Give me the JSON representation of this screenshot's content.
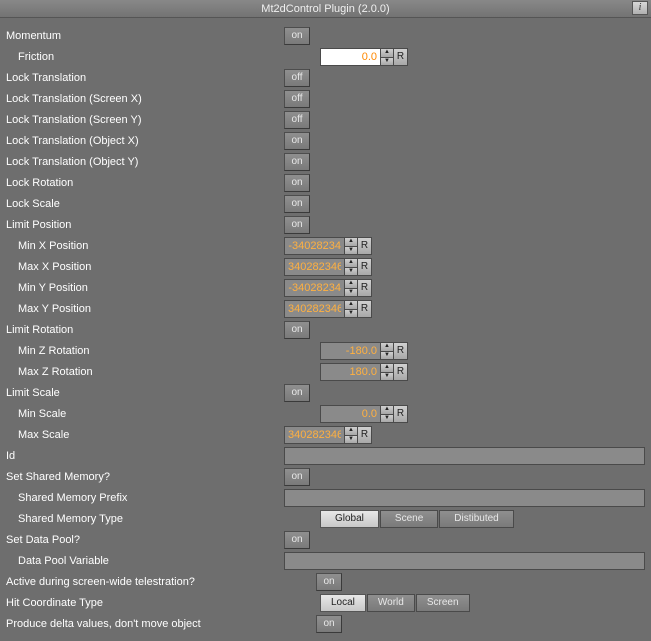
{
  "title": "Mt2dControl Plugin (2.0.0)",
  "info_label": "i",
  "toggle_labels": {
    "on": "on",
    "off": "off"
  },
  "spinner": {
    "up": "▲",
    "down": "▼",
    "reset": "R"
  },
  "rows": {
    "momentum": {
      "label": "Momentum",
      "toggle": "on"
    },
    "friction": {
      "label": "Friction",
      "value": "0.0",
      "highlight": true
    },
    "lock_translation": {
      "label": "Lock Translation",
      "toggle": "off"
    },
    "lock_trans_sx": {
      "label": "Lock Translation (Screen X)",
      "toggle": "off"
    },
    "lock_trans_sy": {
      "label": "Lock Translation (Screen Y)",
      "toggle": "off"
    },
    "lock_trans_ox": {
      "label": "Lock Translation (Object X)",
      "toggle": "on"
    },
    "lock_trans_oy": {
      "label": "Lock Translation (Object Y)",
      "toggle": "on"
    },
    "lock_rotation": {
      "label": "Lock Rotation",
      "toggle": "on"
    },
    "lock_scale": {
      "label": "Lock Scale",
      "toggle": "on"
    },
    "limit_position": {
      "label": "Limit Position",
      "toggle": "on"
    },
    "min_x": {
      "label": "Min X Position",
      "value": "-34028234"
    },
    "max_x": {
      "label": "Max X Position",
      "value": "340282346"
    },
    "min_y": {
      "label": "Min Y Position",
      "value": "-34028234"
    },
    "max_y": {
      "label": "Max Y Position",
      "value": "340282346"
    },
    "limit_rotation": {
      "label": "Limit Rotation",
      "toggle": "on"
    },
    "min_z_rot": {
      "label": "Min Z Rotation",
      "value": "-180.0"
    },
    "max_z_rot": {
      "label": "Max Z Rotation",
      "value": "180.0"
    },
    "limit_scale": {
      "label": "Limit Scale",
      "toggle": "on"
    },
    "min_scale": {
      "label": "Min Scale",
      "value": "0.0"
    },
    "max_scale": {
      "label": "Max Scale",
      "value": "340282346"
    },
    "id": {
      "label": "Id",
      "value": ""
    },
    "set_shared_mem": {
      "label": "Set Shared Memory?",
      "toggle": "on"
    },
    "shared_mem_prefix": {
      "label": "Shared Memory Prefix",
      "value": ""
    },
    "shared_mem_type": {
      "label": "Shared Memory Type",
      "options": [
        "Global",
        "Scene",
        "Distibuted"
      ],
      "selected": 0
    },
    "set_data_pool": {
      "label": "Set Data Pool?",
      "toggle": "on"
    },
    "data_pool_var": {
      "label": "Data Pool Variable",
      "value": ""
    },
    "active_telestration": {
      "label": "Active during screen-wide telestration?",
      "toggle": "on"
    },
    "hit_coord_type": {
      "label": "Hit Coordinate Type",
      "options": [
        "Local",
        "World",
        "Screen"
      ],
      "selected": 0
    },
    "produce_delta": {
      "label": "Produce delta values, don't move object",
      "toggle": "on"
    }
  }
}
